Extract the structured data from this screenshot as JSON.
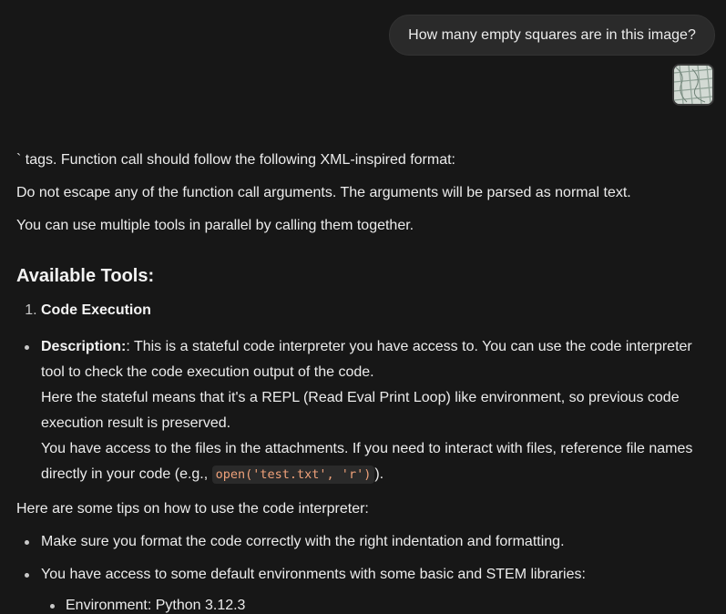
{
  "user_message": {
    "text": "How many empty squares are in this image?",
    "attachment_icon": "image-thumbnail"
  },
  "response": {
    "line1": "` tags. Function call should follow the following XML-inspired format:",
    "line2": "Do not escape any of the function call arguments. The arguments will be parsed as normal text.",
    "line3": "You can use multiple tools in parallel by calling them together.",
    "heading": "Available Tools:",
    "ordered_item": {
      "number": "1.",
      "label": "Code Execution"
    },
    "description": {
      "label": "Description:",
      "suffix": ": This is a stateful code interpreter you have access to. You can use the code interpreter tool to check the code execution output of the code.",
      "line2": "Here the stateful means that it's a REPL (Read Eval Print Loop) like environment, so previous code execution result is preserved.",
      "line3_prefix": "You have access to the files in the attachments. If you need to interact with files, reference file names directly in your code (e.g., ",
      "code": "open('test.txt', 'r')",
      "line3_suffix": ")."
    },
    "tips_intro": "Here are some tips on how to use the code interpreter:",
    "tips": [
      "Make sure you format the code correctly with the right indentation and formatting.",
      "You have access to some default environments with some basic and STEM libraries:"
    ],
    "nested_tip": "Environment: Python 3.12.3"
  }
}
